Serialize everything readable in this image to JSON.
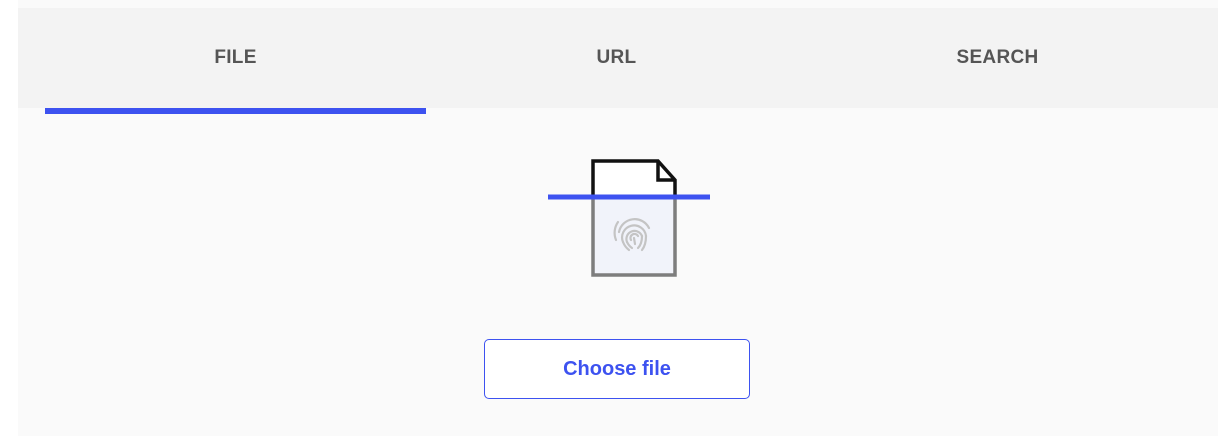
{
  "tabs": [
    {
      "label": "FILE",
      "selected": true
    },
    {
      "label": "URL",
      "selected": false
    },
    {
      "label": "SEARCH",
      "selected": false
    }
  ],
  "upload": {
    "illustration_icon": "fingerprint-document-scan-icon",
    "choose_button_label": "Choose file"
  },
  "colors": {
    "accent": "#3d52f0",
    "tab_text": "#555555",
    "tab_bar_bg": "#f3f3f3",
    "panel_bg": "#fafafa"
  }
}
